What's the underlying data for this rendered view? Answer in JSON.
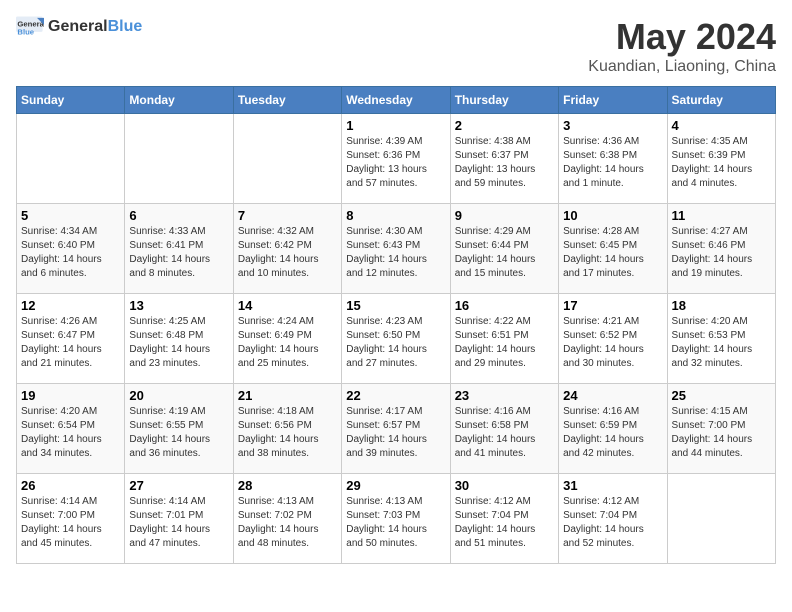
{
  "header": {
    "logo_general": "General",
    "logo_blue": "Blue",
    "month_title": "May 2024",
    "location": "Kuandian, Liaoning, China"
  },
  "days_of_week": [
    "Sunday",
    "Monday",
    "Tuesday",
    "Wednesday",
    "Thursday",
    "Friday",
    "Saturday"
  ],
  "weeks": [
    [
      {
        "day": "",
        "info": ""
      },
      {
        "day": "",
        "info": ""
      },
      {
        "day": "",
        "info": ""
      },
      {
        "day": "1",
        "info": "Sunrise: 4:39 AM\nSunset: 6:36 PM\nDaylight: 13 hours and 57 minutes."
      },
      {
        "day": "2",
        "info": "Sunrise: 4:38 AM\nSunset: 6:37 PM\nDaylight: 13 hours and 59 minutes."
      },
      {
        "day": "3",
        "info": "Sunrise: 4:36 AM\nSunset: 6:38 PM\nDaylight: 14 hours and 1 minute."
      },
      {
        "day": "4",
        "info": "Sunrise: 4:35 AM\nSunset: 6:39 PM\nDaylight: 14 hours and 4 minutes."
      }
    ],
    [
      {
        "day": "5",
        "info": "Sunrise: 4:34 AM\nSunset: 6:40 PM\nDaylight: 14 hours and 6 minutes."
      },
      {
        "day": "6",
        "info": "Sunrise: 4:33 AM\nSunset: 6:41 PM\nDaylight: 14 hours and 8 minutes."
      },
      {
        "day": "7",
        "info": "Sunrise: 4:32 AM\nSunset: 6:42 PM\nDaylight: 14 hours and 10 minutes."
      },
      {
        "day": "8",
        "info": "Sunrise: 4:30 AM\nSunset: 6:43 PM\nDaylight: 14 hours and 12 minutes."
      },
      {
        "day": "9",
        "info": "Sunrise: 4:29 AM\nSunset: 6:44 PM\nDaylight: 14 hours and 15 minutes."
      },
      {
        "day": "10",
        "info": "Sunrise: 4:28 AM\nSunset: 6:45 PM\nDaylight: 14 hours and 17 minutes."
      },
      {
        "day": "11",
        "info": "Sunrise: 4:27 AM\nSunset: 6:46 PM\nDaylight: 14 hours and 19 minutes."
      }
    ],
    [
      {
        "day": "12",
        "info": "Sunrise: 4:26 AM\nSunset: 6:47 PM\nDaylight: 14 hours and 21 minutes."
      },
      {
        "day": "13",
        "info": "Sunrise: 4:25 AM\nSunset: 6:48 PM\nDaylight: 14 hours and 23 minutes."
      },
      {
        "day": "14",
        "info": "Sunrise: 4:24 AM\nSunset: 6:49 PM\nDaylight: 14 hours and 25 minutes."
      },
      {
        "day": "15",
        "info": "Sunrise: 4:23 AM\nSunset: 6:50 PM\nDaylight: 14 hours and 27 minutes."
      },
      {
        "day": "16",
        "info": "Sunrise: 4:22 AM\nSunset: 6:51 PM\nDaylight: 14 hours and 29 minutes."
      },
      {
        "day": "17",
        "info": "Sunrise: 4:21 AM\nSunset: 6:52 PM\nDaylight: 14 hours and 30 minutes."
      },
      {
        "day": "18",
        "info": "Sunrise: 4:20 AM\nSunset: 6:53 PM\nDaylight: 14 hours and 32 minutes."
      }
    ],
    [
      {
        "day": "19",
        "info": "Sunrise: 4:20 AM\nSunset: 6:54 PM\nDaylight: 14 hours and 34 minutes."
      },
      {
        "day": "20",
        "info": "Sunrise: 4:19 AM\nSunset: 6:55 PM\nDaylight: 14 hours and 36 minutes."
      },
      {
        "day": "21",
        "info": "Sunrise: 4:18 AM\nSunset: 6:56 PM\nDaylight: 14 hours and 38 minutes."
      },
      {
        "day": "22",
        "info": "Sunrise: 4:17 AM\nSunset: 6:57 PM\nDaylight: 14 hours and 39 minutes."
      },
      {
        "day": "23",
        "info": "Sunrise: 4:16 AM\nSunset: 6:58 PM\nDaylight: 14 hours and 41 minutes."
      },
      {
        "day": "24",
        "info": "Sunrise: 4:16 AM\nSunset: 6:59 PM\nDaylight: 14 hours and 42 minutes."
      },
      {
        "day": "25",
        "info": "Sunrise: 4:15 AM\nSunset: 7:00 PM\nDaylight: 14 hours and 44 minutes."
      }
    ],
    [
      {
        "day": "26",
        "info": "Sunrise: 4:14 AM\nSunset: 7:00 PM\nDaylight: 14 hours and 45 minutes."
      },
      {
        "day": "27",
        "info": "Sunrise: 4:14 AM\nSunset: 7:01 PM\nDaylight: 14 hours and 47 minutes."
      },
      {
        "day": "28",
        "info": "Sunrise: 4:13 AM\nSunset: 7:02 PM\nDaylight: 14 hours and 48 minutes."
      },
      {
        "day": "29",
        "info": "Sunrise: 4:13 AM\nSunset: 7:03 PM\nDaylight: 14 hours and 50 minutes."
      },
      {
        "day": "30",
        "info": "Sunrise: 4:12 AM\nSunset: 7:04 PM\nDaylight: 14 hours and 51 minutes."
      },
      {
        "day": "31",
        "info": "Sunrise: 4:12 AM\nSunset: 7:04 PM\nDaylight: 14 hours and 52 minutes."
      },
      {
        "day": "",
        "info": ""
      }
    ]
  ]
}
